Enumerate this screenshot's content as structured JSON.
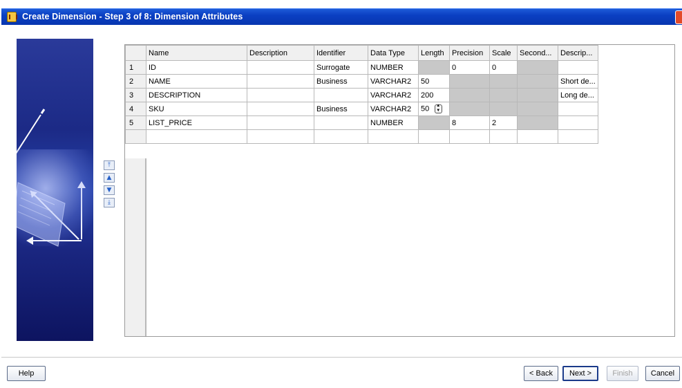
{
  "window": {
    "title": "Create Dimension - Step 3 of 8: Dimension Attributes"
  },
  "grid": {
    "columns": [
      "Name",
      "Description",
      "Identifier",
      "Data Type",
      "Length",
      "Precision",
      "Scale",
      "Second...",
      "Descrip..."
    ],
    "rows": [
      {
        "num": "1",
        "name": "ID",
        "description": "",
        "identifier": "Surrogate",
        "data_type": "NUMBER",
        "length": "",
        "precision": "0",
        "scale": "0",
        "second": "",
        "descrip": ""
      },
      {
        "num": "2",
        "name": "NAME",
        "description": "",
        "identifier": "Business",
        "data_type": "VARCHAR2",
        "length": "50",
        "precision": "",
        "scale": "",
        "second": "",
        "descrip": "Short de..."
      },
      {
        "num": "3",
        "name": "DESCRIPTION",
        "description": "",
        "identifier": "",
        "data_type": "VARCHAR2",
        "length": "200",
        "precision": "",
        "scale": "",
        "second": "",
        "descrip": "Long de..."
      },
      {
        "num": "4",
        "name": "SKU",
        "description": "",
        "identifier": "Business",
        "data_type": "VARCHAR2",
        "length": "50",
        "precision": "",
        "scale": "",
        "second": "",
        "descrip": ""
      },
      {
        "num": "5",
        "name": "LIST_PRICE",
        "description": "",
        "identifier": "",
        "data_type": "NUMBER",
        "length": "",
        "precision": "8",
        "scale": "2",
        "second": "",
        "descrip": ""
      }
    ]
  },
  "buttons": {
    "help": "Help",
    "back": "< Back",
    "next": "Next >",
    "finish": "Finish",
    "cancel": "Cancel"
  },
  "move_buttons": [
    "move-top-icon",
    "move-up-icon",
    "move-down-icon",
    "move-bottom-icon"
  ],
  "colors": {
    "title_bar": "#0a3fc2",
    "disabled_cell": "#c8c8c8"
  }
}
